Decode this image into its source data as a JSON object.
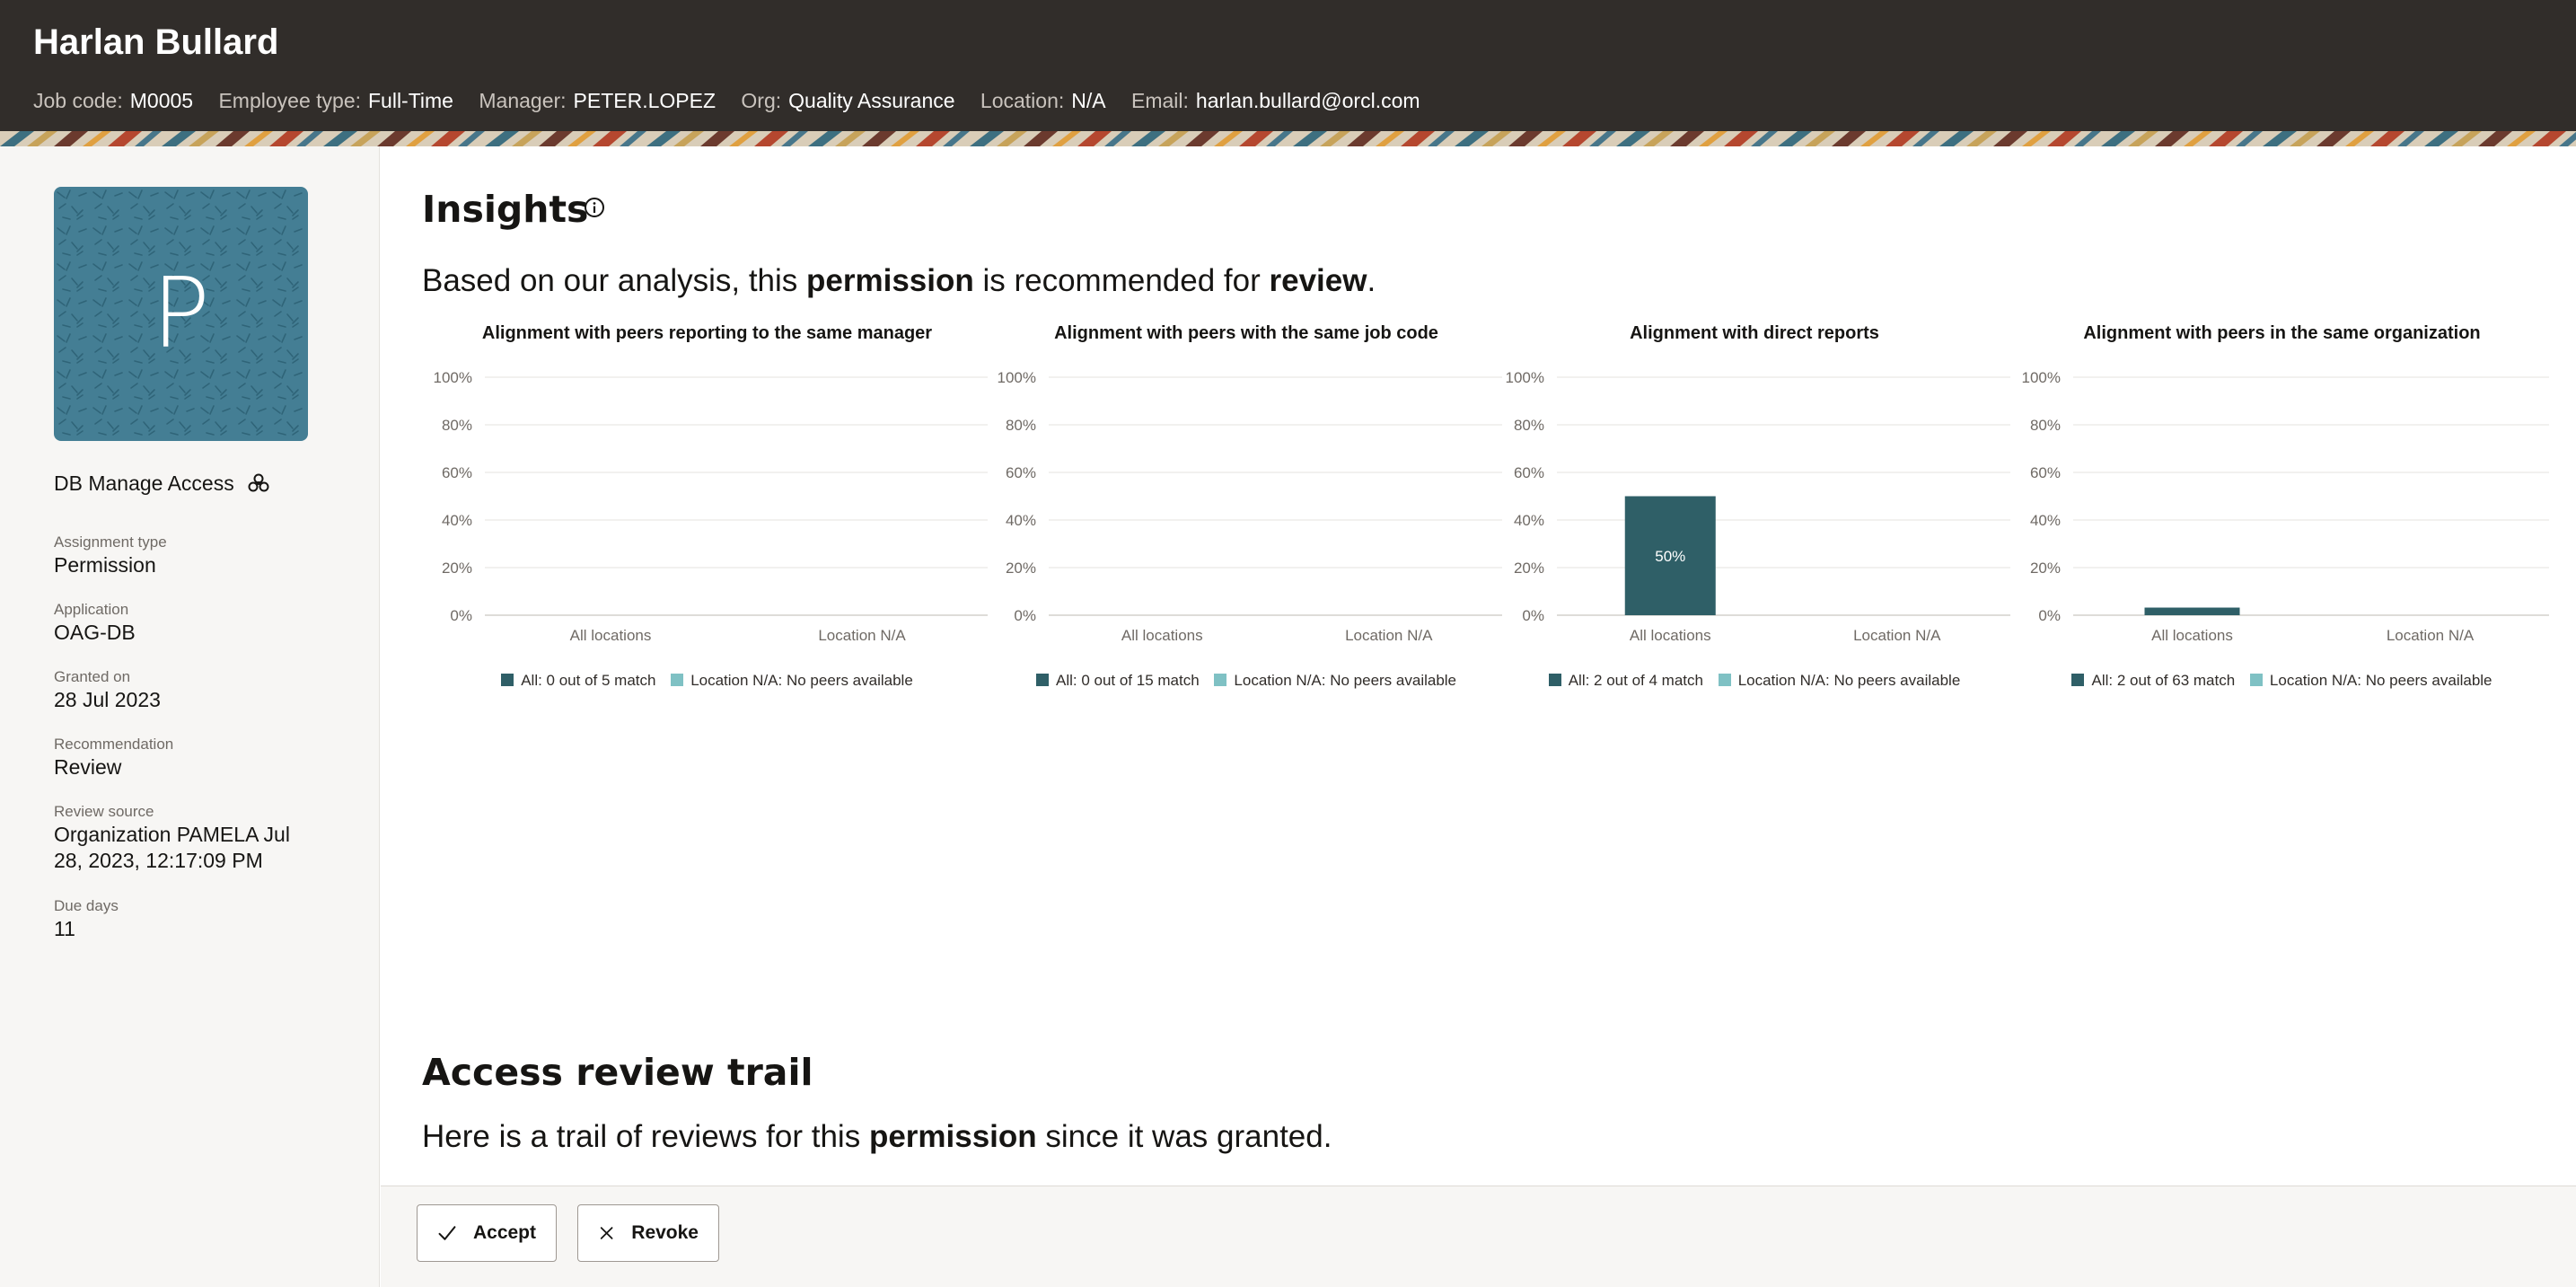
{
  "header": {
    "name": "Harlan Bullard",
    "meta": [
      {
        "label": "Job code:",
        "value": "M0005"
      },
      {
        "label": "Employee type:",
        "value": "Full-Time"
      },
      {
        "label": "Manager:",
        "value": "PETER.LOPEZ"
      },
      {
        "label": "Org:",
        "value": "Quality Assurance"
      },
      {
        "label": "Location:",
        "value": "N/A"
      },
      {
        "label": "Email:",
        "value": "harlan.bullard@orcl.com"
      }
    ]
  },
  "sidebar": {
    "avatar_letter": "P",
    "avatar_color": "#447e94",
    "entitlement_name": "DB Manage Access",
    "entitlement_icon": "bundle-icon",
    "fields": [
      {
        "label": "Assignment type",
        "value": "Permission"
      },
      {
        "label": "Application",
        "value": "OAG-DB"
      },
      {
        "label": "Granted on",
        "value": "28 Jul 2023"
      },
      {
        "label": "Recommendation",
        "value": "Review"
      },
      {
        "label": "Review source",
        "value": "Organization PAMELA Jul 28, 2023, 12:17:09 PM"
      },
      {
        "label": "Due days",
        "value": "11"
      }
    ]
  },
  "insights": {
    "title": "Insights",
    "info_icon": "info-icon",
    "sentence": {
      "before": "Based on our analysis, this ",
      "entity": "permission",
      "middle": " is recommended for ",
      "recommendation": "review",
      "after": "."
    }
  },
  "colors": {
    "series_all": "#2f5f67",
    "series_location": "#7fc1c4",
    "header_bg": "#312d2a"
  },
  "chart_data": [
    {
      "type": "bar",
      "title": "Alignment with peers reporting to the same manager",
      "categories": [
        "All locations",
        "Location N/A"
      ],
      "yticks": [
        "0%",
        "20%",
        "40%",
        "60%",
        "80%",
        "100%"
      ],
      "ylim": [
        0,
        100
      ],
      "series": [
        {
          "name": "All: 0 out of 5 match",
          "values": [
            0,
            null
          ]
        },
        {
          "name": "Location N/A: No peers available",
          "values": [
            null,
            null
          ]
        }
      ],
      "data_labels": [
        "",
        ""
      ]
    },
    {
      "type": "bar",
      "title": "Alignment with peers with the same job code",
      "categories": [
        "All locations",
        "Location N/A"
      ],
      "yticks": [
        "0%",
        "20%",
        "40%",
        "60%",
        "80%",
        "100%"
      ],
      "ylim": [
        0,
        100
      ],
      "series": [
        {
          "name": "All: 0 out of 15 match",
          "values": [
            0,
            null
          ]
        },
        {
          "name": "Location N/A: No peers available",
          "values": [
            null,
            null
          ]
        }
      ],
      "data_labels": [
        "",
        ""
      ]
    },
    {
      "type": "bar",
      "title": "Alignment with direct reports",
      "categories": [
        "All locations",
        "Location N/A"
      ],
      "yticks": [
        "0%",
        "20%",
        "40%",
        "60%",
        "80%",
        "100%"
      ],
      "ylim": [
        0,
        100
      ],
      "series": [
        {
          "name": "All: 2 out of 4 match",
          "values": [
            50,
            null
          ]
        },
        {
          "name": "Location N/A: No peers available",
          "values": [
            null,
            null
          ]
        }
      ],
      "data_labels": [
        "50%",
        ""
      ]
    },
    {
      "type": "bar",
      "title": "Alignment with peers in the same organization",
      "categories": [
        "All locations",
        "Location N/A"
      ],
      "yticks": [
        "0%",
        "20%",
        "40%",
        "60%",
        "80%",
        "100%"
      ],
      "ylim": [
        0,
        100
      ],
      "series": [
        {
          "name": "All: 2 out of 63 match",
          "values": [
            3.2,
            null
          ]
        },
        {
          "name": "Location N/A: No peers available",
          "values": [
            null,
            null
          ]
        }
      ],
      "data_labels": [
        "",
        ""
      ]
    }
  ],
  "trail": {
    "title": "Access review trail",
    "sentence": {
      "before": "Here is a trail of reviews for this ",
      "entity": "permission",
      "after": " since it was granted."
    }
  },
  "footer": {
    "accept_label": "Accept",
    "accept_icon": "check-icon",
    "revoke_label": "Revoke",
    "revoke_icon": "close-icon"
  }
}
